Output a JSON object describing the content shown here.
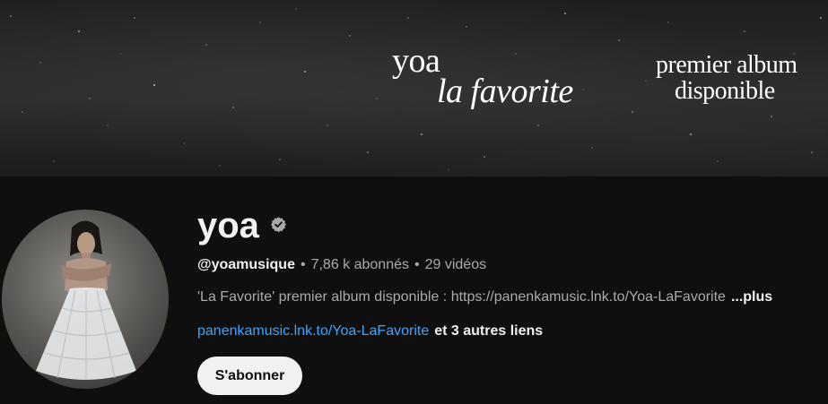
{
  "banner": {
    "artist": "yoa",
    "album": "la favorite",
    "tagline_line1": "premier album",
    "tagline_line2": "disponible"
  },
  "channel": {
    "name": "yoa",
    "verified": true,
    "handle": "@yoamusique",
    "separator": "•",
    "subscribers": "7,86 k abonnés",
    "videos": "29 vidéos",
    "description": "'La Favorite' premier album disponible : https://panenkamusic.lnk.to/Yoa-LaFavorite",
    "more_label": "...plus",
    "link_text": "panenkamusic.lnk.to/Yoa-LaFavorite",
    "other_links": "et 3 autres liens",
    "subscribe_label": "S'abonner"
  },
  "colors": {
    "background": "#0f0f0f",
    "link": "#3ea6ff",
    "subscribe_bg": "#f1f1f1"
  },
  "icons": {
    "verified": "verified-badge-icon"
  }
}
